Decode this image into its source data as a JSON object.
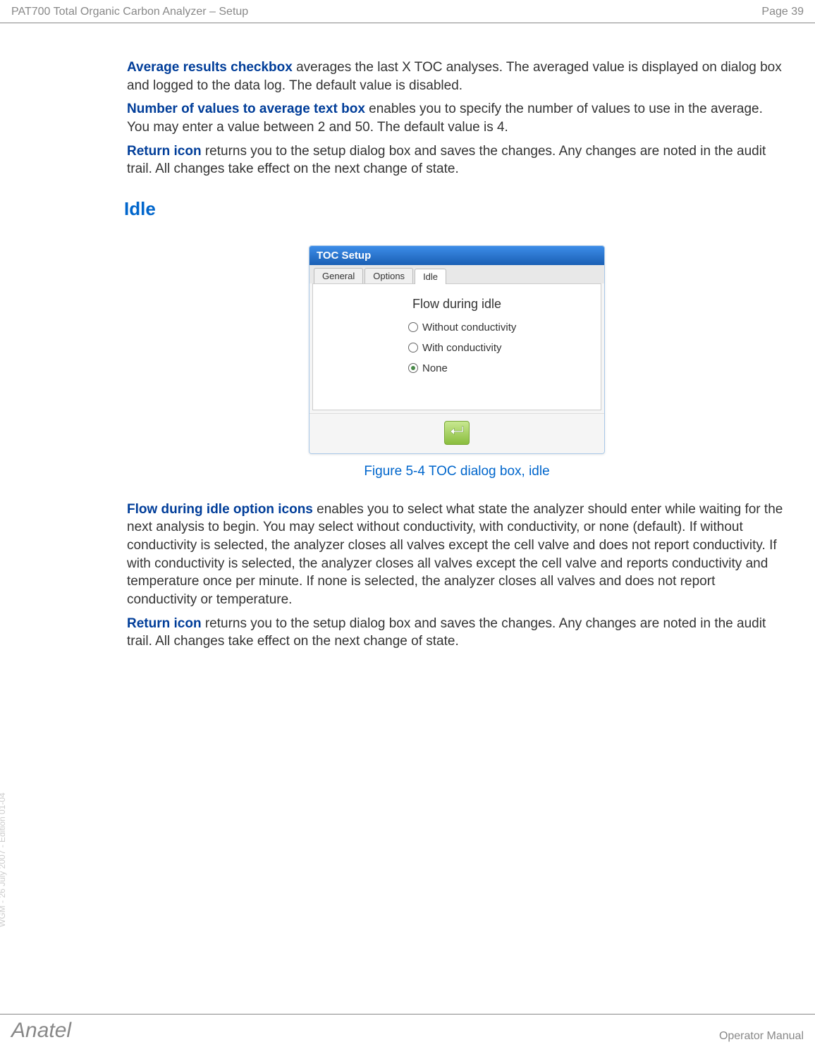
{
  "header": {
    "title": "PAT700 Total Organic Carbon Analyzer – Setup",
    "page_label": "Page 39"
  },
  "intro": {
    "para1_bold": "Average results checkbox",
    "para1_rest": " averages the last X TOC analyses. The averaged value is displayed on dialog box and logged to the data log. The default value is disabled.",
    "para2_bold": "Number of values to average text box",
    "para2_rest": " enables you to specify the number of values to use in the average. You may enter a value between 2 and 50. The default value is 4.",
    "para3_bold": "Return icon",
    "para3_rest": " returns you to the setup dialog box and saves the changes. Any changes are noted in the audit trail. All changes take effect on the next change of state."
  },
  "section_heading": "Idle",
  "dialog": {
    "title": "TOC Setup",
    "tabs": [
      "General",
      "Options",
      "Idle"
    ],
    "active_tab_index": 2,
    "section_title": "Flow during idle",
    "options": [
      {
        "label": "Without conductivity",
        "selected": false
      },
      {
        "label": "With conductivity",
        "selected": false
      },
      {
        "label": "None",
        "selected": true
      }
    ]
  },
  "figure_caption": "Figure 5-4 TOC dialog box, idle",
  "body": {
    "para1_bold": "Flow during idle option icons",
    "para1_rest": " enables you to select what state the analyzer should enter while waiting for the next analysis to begin. You may select without conductivity, with conductivity, or none (default). If without conductivity is selected, the analyzer closes all valves except the cell valve and does not report conductivity. If with conductivity is selected, the analyzer closes all valves except the cell valve and reports conductivity and temperature once per minute. If none is selected, the analyzer closes all valves and does not report conductivity or temperature.",
    "para2_bold": "Return icon",
    "para2_rest": " returns you to the setup dialog box and saves the changes. Any changes are noted in the audit trail. All changes take effect on the next change of state."
  },
  "footer": {
    "brand": "Anatel",
    "manual": "Operator Manual"
  },
  "side_text": "WGM - 26 July 2007 - Edition 01-04"
}
